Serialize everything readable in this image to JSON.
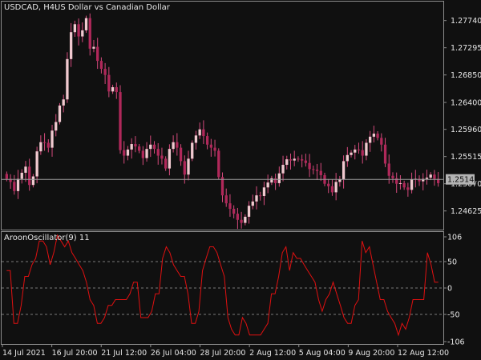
{
  "header": {
    "symbol_timeframe": "USDCAD, H4:",
    "description": "US Dollar vs Canadian Dollar"
  },
  "indicator": {
    "label": "AroonOscillator(9) 11"
  },
  "current_price": "1.25142",
  "colors": {
    "background": "#101010",
    "frame": "#8c8c8c",
    "bull_candle": "#f0c9cf",
    "bear_candle": "#b0285a",
    "wick": "#d44a7c",
    "price_line": "#9a9a9a",
    "oscillator_line": "#e01010",
    "level_line": "#7a7a7a"
  },
  "chart_data": [
    {
      "type": "candlestick",
      "title": "USDCAD, H4:  US Dollar vs Canadian Dollar",
      "y_ticks": [
        1.2774,
        1.27295,
        1.2685,
        1.264,
        1.2596,
        1.25515,
        1.2507,
        1.24625
      ],
      "y_tick_labels": [
        "1.27740",
        "1.27295",
        "1.26850",
        "1.26400",
        "1.25960",
        "1.25515",
        "1.25070",
        "1.24625"
      ],
      "ylim": [
        1.2432,
        1.2805
      ],
      "x_tick_labels": [
        "14 Jul 2021",
        "16 Jul 20:00",
        "21 Jul 12:00",
        "26 Jul 04:00",
        "28 Jul 20:00",
        "2 Aug 12:00",
        "5 Aug 04:00",
        "9 Aug 20:00",
        "12 Aug 12:00"
      ],
      "last_price": 1.25142,
      "close_series": [
        1.2515,
        1.251,
        1.2495,
        1.2515,
        1.2525,
        1.2535,
        1.2505,
        1.2519,
        1.256,
        1.2575,
        1.2574,
        1.2566,
        1.2594,
        1.2608,
        1.2635,
        1.2645,
        1.2711,
        1.2755,
        1.2768,
        1.2748,
        1.2758,
        1.2778,
        1.2728,
        1.2731,
        1.2708,
        1.2695,
        1.2685,
        1.2658,
        1.2665,
        1.2657,
        1.2562,
        1.2553,
        1.2563,
        1.2572,
        1.2568,
        1.2561,
        1.2549,
        1.2564,
        1.2571,
        1.2564,
        1.2553,
        1.2548,
        1.2532,
        1.2564,
        1.2575,
        1.2566,
        1.2544,
        1.2522,
        1.2548,
        1.2574,
        1.2586,
        1.2596,
        1.2585,
        1.2571,
        1.2566,
        1.2561,
        1.2518,
        1.2488,
        1.2475,
        1.2466,
        1.2458,
        1.2448,
        1.2443,
        1.2453,
        1.2471,
        1.2478,
        1.2488,
        1.2487,
        1.2501,
        1.2509,
        1.2516,
        1.2508,
        1.2524,
        1.2538,
        1.2547,
        1.2545,
        1.2548,
        1.2547,
        1.2545,
        1.2541,
        1.2531,
        1.253,
        1.2528,
        1.2521,
        1.2507,
        1.2503,
        1.2493,
        1.251,
        1.2514,
        1.2544,
        1.2554,
        1.2558,
        1.2563,
        1.2562,
        1.2553,
        1.2574,
        1.2584,
        1.2589,
        1.2582,
        1.2571,
        1.254,
        1.252,
        1.2516,
        1.2507,
        1.2508,
        1.2501,
        1.2497,
        1.2514,
        1.2515,
        1.2511,
        1.2515,
        1.2517,
        1.2522,
        1.2515,
        1.2508
      ]
    },
    {
      "type": "line",
      "series": [
        {
          "name": "AroonOscillator(9)",
          "values": [
            33,
            33,
            -67,
            -67,
            -33,
            22,
            22,
            44,
            56,
            89,
            89,
            78,
            44,
            67,
            100,
            89,
            78,
            89,
            67,
            56,
            44,
            33,
            11,
            -22,
            -33,
            -67,
            -67,
            -56,
            -33,
            -33,
            -22,
            -22,
            -22,
            -22,
            -11,
            11,
            11,
            -56,
            -56,
            -56,
            -44,
            -11,
            -11,
            56,
            78,
            67,
            44,
            33,
            22,
            22,
            -11,
            -67,
            -67,
            -44,
            33,
            56,
            78,
            78,
            67,
            44,
            22,
            -56,
            -78,
            -89,
            -89,
            -56,
            -67,
            -89,
            -89,
            -89,
            -89,
            -78,
            -67,
            -11,
            -11,
            22,
            67,
            78,
            33,
            67,
            56,
            56,
            44,
            33,
            22,
            11,
            -22,
            -44,
            -22,
            -11,
            11,
            -11,
            -33,
            -56,
            -67,
            -67,
            -33,
            -22,
            89,
            67,
            78,
            44,
            11,
            -22,
            -22,
            -44,
            -56,
            -67,
            -89,
            -67,
            -78,
            -56,
            -22,
            -22,
            -22,
            -22,
            67,
            44,
            11,
            11
          ]
        }
      ],
      "y_ticks": [
        106,
        50,
        0,
        -50,
        -106
      ],
      "y_tick_labels": [
        "106",
        "50",
        "0",
        "-50",
        "-106"
      ],
      "ylim": [
        -106,
        106
      ],
      "levels": [
        50,
        0,
        -50
      ]
    }
  ]
}
